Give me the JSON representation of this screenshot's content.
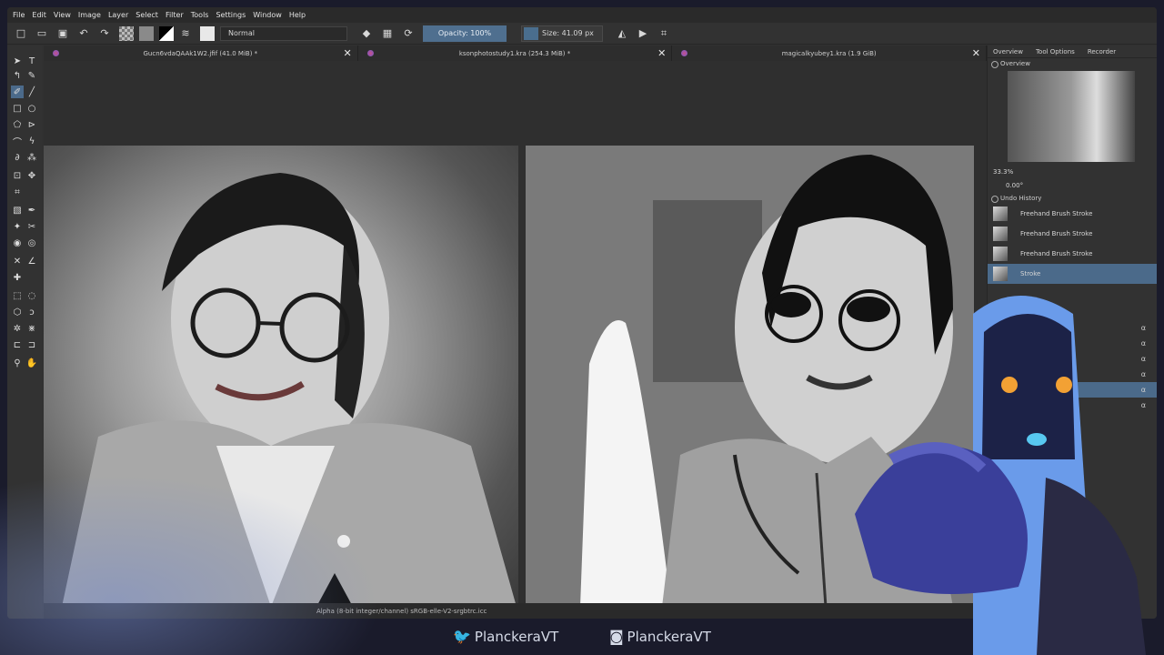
{
  "menu": [
    "File",
    "Edit",
    "View",
    "Image",
    "Layer",
    "Select",
    "Filter",
    "Tools",
    "Settings",
    "Window",
    "Help"
  ],
  "toolbar": {
    "blend_mode": "Normal",
    "opacity_label": "Opacity: 100%",
    "size_label": "Size: 41.09 px"
  },
  "tabs": [
    {
      "label": "Gucn6vdaQAAk1W2.jfif (41.0 MiB) *"
    },
    {
      "label": "ksonphotostudy1.kra (254.3 MiB) *"
    },
    {
      "label": "magicalkyubey1.kra (1.9 GiB)"
    }
  ],
  "status": {
    "text": "Alpha (8-bit integer/channel)  sRGB-elle-V2-srgbtrc.icc"
  },
  "dock": {
    "tabs": [
      "Overview",
      "Tool Options",
      "Recorder"
    ],
    "overview_title": "Overview",
    "zoom": "33.3%",
    "rotation": "0.00°",
    "undo_title": "Undo History",
    "history": [
      {
        "label": "Freehand Brush Stroke"
      },
      {
        "label": "Freehand Brush Stroke"
      },
      {
        "label": "Freehand Brush Stroke"
      },
      {
        "label": "Stroke"
      }
    ],
    "layer_glyph": "α",
    "layer_rows": 6
  },
  "social": {
    "twitter": "PlanckeraVT",
    "instagram": "PlanckeraVT"
  },
  "colors": {
    "accent": "#4b6a8a",
    "opacity_bar": "#4f6f8f",
    "bg": "#313131"
  },
  "icons": [
    "twitter-icon",
    "instagram-icon",
    "close-icon",
    "eraser-icon",
    "crop-icon",
    "mirror-icon"
  ]
}
